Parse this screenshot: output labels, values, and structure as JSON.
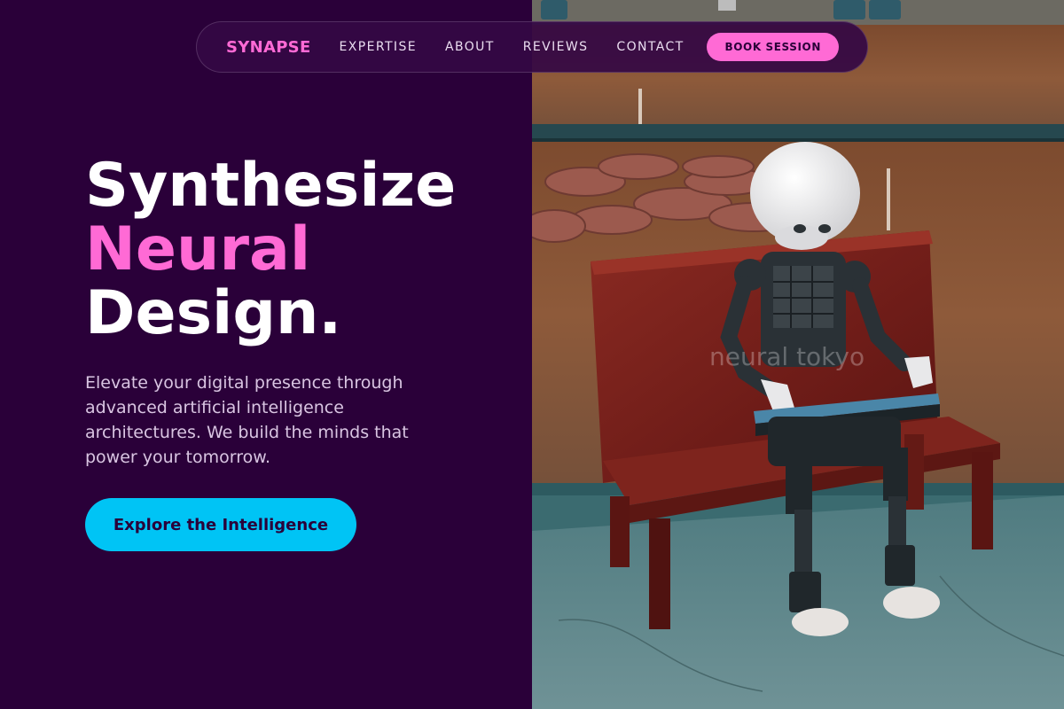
{
  "brand": "SYNAPSE",
  "nav": {
    "links": [
      "EXPERTISE",
      "ABOUT",
      "REVIEWS",
      "CONTACT"
    ],
    "cta_label": "BOOK SESSION"
  },
  "hero": {
    "title_line1": "Synthesize",
    "title_line2": "Neural",
    "title_line3": "Design.",
    "subtitle": "Elevate your digital presence through advanced artificial intelligence architectures. We build the minds that power your tomorrow.",
    "cta_label": "Explore the Intelligence"
  },
  "photo": {
    "subject": "robot-on-bench",
    "watermark": "neural tokyo"
  },
  "colors": {
    "background": "#2a0039",
    "accent_pink": "#ff6ad5",
    "accent_cyan": "#00c4f5",
    "text_light": "#d9c5e2"
  }
}
